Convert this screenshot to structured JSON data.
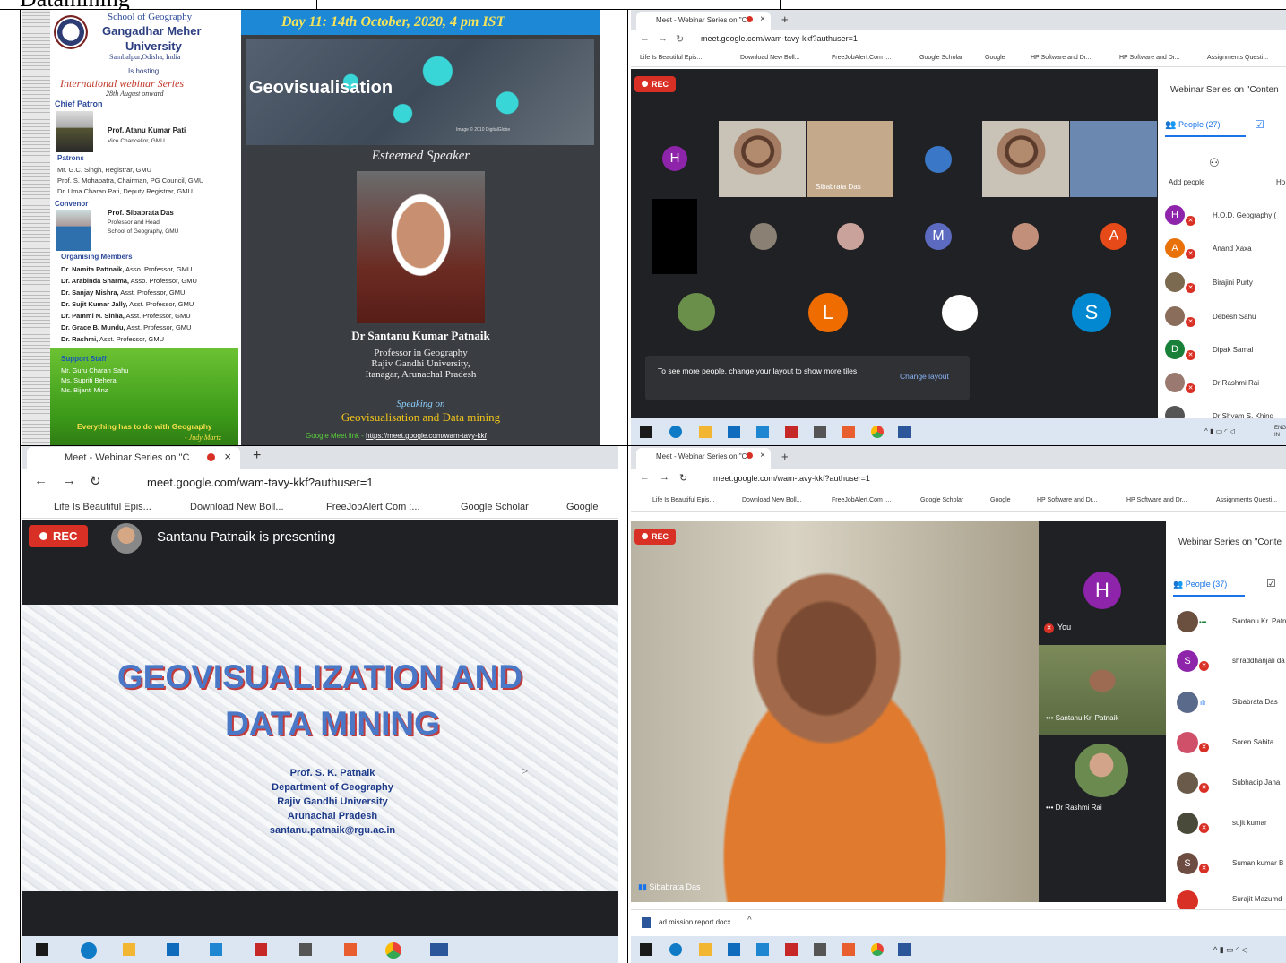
{
  "header": {
    "text": "Datamining"
  },
  "poster": {
    "school": "School of Geography",
    "university_line1": "Gangadhar Meher",
    "university_line2": "University",
    "location": "Sambalpur,Odisha, India",
    "is_hosting": "Is hosting",
    "series": "International webinar Series",
    "series_date": "28th August onward",
    "chief_patron_label": "Chief Patron",
    "chief_patron_name": "Prof. Atanu Kumar Pati",
    "chief_patron_title": "Vice Chancellor, GMU",
    "patrons_label": "Patrons",
    "patrons": [
      "Mr. G.C. Singh, Registrar, GMU",
      "Prof. S. Mohapatra, Chairman, PG Council, GMU",
      "Dr. Uma Charan Pati, Deputy Registrar, GMU"
    ],
    "convenor_label": "Convenor",
    "convenor_name": "Prof. Sibabrata Das",
    "convenor_title1": "Professor and Head",
    "convenor_title2": "School of Geography, GMU",
    "organising_label": "Organising Members",
    "organising": [
      {
        "name": "Dr. Namita Pattnaik,",
        "role": " Asso. Professor, GMU"
      },
      {
        "name": "Dr. Arabinda Sharma,",
        "role": " Asso. Professor, GMU"
      },
      {
        "name": "Dr. Sanjay Mishra,",
        "role": " Asst. Professor, GMU"
      },
      {
        "name": "Dr. Sujit Kumar Jally,",
        "role": " Asst. Professor, GMU"
      },
      {
        "name": "Dr. Pammi N. Sinha,",
        "role": " Asst. Professor, GMU"
      },
      {
        "name": "Dr. Grace B. Mundu,",
        "role": " Asst. Professor, GMU"
      },
      {
        "name": "Dr. Rashmi,",
        "role": " Asst. Professor, GMU"
      }
    ],
    "support_label": "Support Staff",
    "support": [
      "Mr. Guru Charan Sahu",
      "Ms. Supriti Behera",
      "Ms. Bijanti Minz"
    ],
    "quote": "Everything has to do with Geography",
    "quote_author": "- Judy Martz",
    "day_banner": "Day 11: 14th October, 2020, 4 pm IST",
    "geo_title": "Geovisualisation",
    "map_credit": "Image © 2010 DigitalGlobe",
    "esteemed": "Esteemed Speaker",
    "speaker_name": "Dr Santanu Kumar Patnaik",
    "speaker_line1": "Professor in Geography",
    "speaker_line2": "Rajiv Gandhi University,",
    "speaker_line3": "Itanagar, Arunachal Pradesh",
    "speaking_on": "Speaking on",
    "topic": "Geovisualisation and Data mining",
    "meet_link_label": "Google Meet link - ",
    "meet_link": "https://meet.google.com/wam-tavy-kkf"
  },
  "q2": {
    "tab_title": "Meet - Webinar Series on \"C",
    "url": "meet.google.com/wam-tavy-kkf?authuser=1",
    "bookmarks": [
      "Life Is Beautiful Epis...",
      "Download New Boll...",
      "FreeJobAlert.Com :...",
      "Google Scholar",
      "Google",
      "HP Software and Dr...",
      "HP Software and Dr...",
      "Assignments Questi..."
    ],
    "rec": "REC",
    "tile_letters": [
      "H",
      "M",
      "A",
      "L",
      "S"
    ],
    "name_tag": "Sibabrata Das",
    "notice": "To see more people, change your layout to show more tiles",
    "change_layout": "Change layout",
    "side_title": "Webinar Series on \"Conten",
    "people_tab": "People (27)",
    "add_people": "Add people",
    "host_label": "Ho",
    "people": [
      {
        "initial": "H",
        "name": "H.O.D. Geography (",
        "color": "#8e24aa"
      },
      {
        "initial": "A",
        "name": "Anand Xaxa",
        "color": "#e8710a"
      },
      {
        "initial": "",
        "name": "Birajini Purty",
        "color": "#7b6a50"
      },
      {
        "initial": "",
        "name": "Debesh Sahu",
        "color": "#8a6d5a"
      },
      {
        "initial": "D",
        "name": "Dipak Samal",
        "color": "#188038"
      },
      {
        "initial": "",
        "name": "Dr Rashmi Rai",
        "color": "#9a7a70"
      },
      {
        "initial": "",
        "name": "Dr Shyam S. Khing",
        "color": "#555"
      }
    ],
    "tray": "ENG IN"
  },
  "q3": {
    "tab_title": "Meet - Webinar Series on \"C",
    "url": "meet.google.com/wam-tavy-kkf?authuser=1",
    "bookmarks": [
      "Life Is Beautiful Epis...",
      "Download New Boll...",
      "FreeJobAlert.Com :...",
      "Google Scholar",
      "Google"
    ],
    "rec": "REC",
    "presenting": "Santanu Patnaik is presenting",
    "slide_title1": "GEOVISUALIZATION AND",
    "slide_title2": "DATA MINING",
    "slide_lines": [
      "Prof. S. K. Patnaik",
      "Department of Geography",
      "Rajiv Gandhi University",
      "Arunachal Pradesh",
      "santanu.patnaik@rgu.ac.in"
    ]
  },
  "q4": {
    "tab_title": "Meet - Webinar Series on \"C",
    "url": "meet.google.com/wam-tavy-kkf?authuser=1",
    "bookmarks": [
      "Life Is Beautiful Epis...",
      "Download New Boll...",
      "FreeJobAlert.Com :...",
      "Google Scholar",
      "Google",
      "HP Software and Dr...",
      "HP Software and Dr...",
      "Assignments Questi..."
    ],
    "rec": "REC",
    "main_name": "Sibabrata Das",
    "you_letter": "H",
    "you_label": "You",
    "tile2_name": "Santanu Kr. Patnaik",
    "tile3_name": "Dr Rashmi Rai",
    "side_title": "Webinar Series on \"Conte",
    "people_tab": "People (37)",
    "people": [
      {
        "initial": "",
        "name": "Santanu Kr. Patn",
        "color": "#6b5040"
      },
      {
        "initial": "S",
        "name": "shraddhanjali da",
        "color": "#8e24aa"
      },
      {
        "initial": "",
        "name": "Sibabrata Das",
        "color": "#5a6a8a"
      },
      {
        "initial": "",
        "name": "Soren Sabita",
        "color": "#d0506a"
      },
      {
        "initial": "",
        "name": "Subhadip Jana",
        "color": "#6a5a4a"
      },
      {
        "initial": "",
        "name": "sujit kumar",
        "color": "#4a4a3a"
      },
      {
        "initial": "S",
        "name": "Suman kumar B",
        "color": "#6d4c41"
      },
      {
        "initial": "",
        "name": "Surajit Mazumd",
        "color": "#d93025"
      }
    ],
    "download": "ad mission report.docx"
  },
  "colors": {
    "rec": "#d93025",
    "meet_bg": "#202124",
    "accent": "#1a73e8",
    "taskbar": "#dbe6f2"
  }
}
